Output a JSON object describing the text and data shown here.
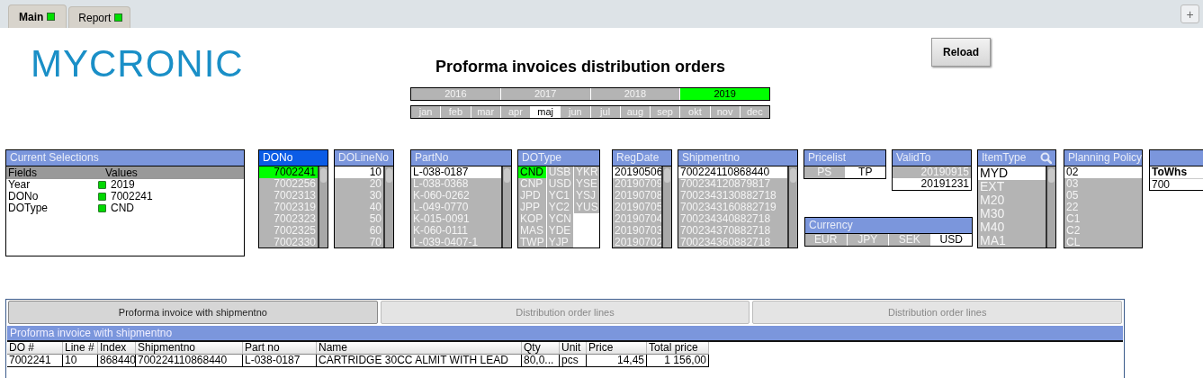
{
  "tabs": [
    {
      "label": "Main",
      "selected": true
    },
    {
      "label": "Report",
      "selected": false
    }
  ],
  "add_tab_button": "+",
  "logo": "MYCRONIC",
  "title": "Proforma invoices distribution orders",
  "reload_button": "Reload",
  "year_selector": [
    {
      "label": "2016",
      "selected": false,
      "excluded": true
    },
    {
      "label": "2017",
      "selected": false,
      "excluded": true
    },
    {
      "label": "2018",
      "selected": false,
      "excluded": true
    },
    {
      "label": "2019",
      "selected": true,
      "excluded": false
    }
  ],
  "month_selector": [
    {
      "label": "jan",
      "selected": false,
      "excluded": true
    },
    {
      "label": "feb",
      "selected": false,
      "excluded": true
    },
    {
      "label": "mar",
      "selected": false,
      "excluded": true
    },
    {
      "label": "apr",
      "selected": false,
      "excluded": true
    },
    {
      "label": "maj",
      "selected": false,
      "excluded": false
    },
    {
      "label": "jun",
      "selected": false,
      "excluded": true
    },
    {
      "label": "jul",
      "selected": false,
      "excluded": true
    },
    {
      "label": "aug",
      "selected": false,
      "excluded": true
    },
    {
      "label": "sep",
      "selected": false,
      "excluded": true
    },
    {
      "label": "okt",
      "selected": false,
      "excluded": true
    },
    {
      "label": "nov",
      "selected": false,
      "excluded": true
    },
    {
      "label": "dec",
      "selected": false,
      "excluded": true
    }
  ],
  "current_selections": {
    "title": "Current Selections",
    "columns": [
      "Fields",
      "Values"
    ],
    "rows": [
      {
        "field": "Year",
        "value": "2019"
      },
      {
        "field": "DONo",
        "value": "7002241"
      },
      {
        "field": "DOType",
        "value": "CND"
      }
    ]
  },
  "listboxes": [
    {
      "title": "DONo",
      "kind": "number",
      "active": true,
      "scrollbar": true,
      "items": [
        {
          "label": "7002241",
          "selected": true,
          "excluded": false
        },
        {
          "label": "7002256",
          "selected": false,
          "excluded": true
        },
        {
          "label": "7002313",
          "selected": false,
          "excluded": true
        },
        {
          "label": "7002319",
          "selected": false,
          "excluded": true
        },
        {
          "label": "7002323",
          "selected": false,
          "excluded": true
        },
        {
          "label": "7002325",
          "selected": false,
          "excluded": true
        },
        {
          "label": "7002330",
          "selected": false,
          "excluded": true
        }
      ]
    },
    {
      "title": "DOLineNo",
      "kind": "number",
      "active": false,
      "scrollbar": true,
      "items": [
        {
          "label": "10",
          "selected": false,
          "excluded": false
        },
        {
          "label": "20",
          "selected": false,
          "excluded": true
        },
        {
          "label": "30",
          "selected": false,
          "excluded": true
        },
        {
          "label": "40",
          "selected": false,
          "excluded": true
        },
        {
          "label": "50",
          "selected": false,
          "excluded": true
        },
        {
          "label": "60",
          "selected": false,
          "excluded": true
        },
        {
          "label": "70",
          "selected": false,
          "excluded": true
        }
      ]
    },
    {
      "title": "PartNo",
      "kind": "text",
      "active": false,
      "scrollbar": true,
      "items": [
        {
          "label": "L-038-0187",
          "selected": false,
          "excluded": false
        },
        {
          "label": "L-038-0368",
          "selected": false,
          "excluded": true
        },
        {
          "label": "K-060-0262",
          "selected": false,
          "excluded": true
        },
        {
          "label": "L-049-0770",
          "selected": false,
          "excluded": true
        },
        {
          "label": "K-015-0091",
          "selected": false,
          "excluded": true
        },
        {
          "label": "K-060-0111",
          "selected": false,
          "excluded": true
        },
        {
          "label": "L-039-0407-1",
          "selected": false,
          "excluded": true
        }
      ]
    },
    {
      "title": "DOType",
      "kind": "grid",
      "active": false,
      "scrollbar": false,
      "items": [
        {
          "label": "CND",
          "selected": true,
          "excluded": false
        },
        {
          "label": "CNP",
          "selected": false,
          "excluded": true
        },
        {
          "label": "JPD",
          "selected": false,
          "excluded": true
        },
        {
          "label": "JPP",
          "selected": false,
          "excluded": true
        },
        {
          "label": "KOP",
          "selected": false,
          "excluded": true
        },
        {
          "label": "MAS",
          "selected": false,
          "excluded": true
        },
        {
          "label": "TWP",
          "selected": false,
          "excluded": true
        },
        {
          "label": "USB",
          "selected": false,
          "excluded": true
        },
        {
          "label": "USD",
          "selected": false,
          "excluded": true
        },
        {
          "label": "YC1",
          "selected": false,
          "excluded": true
        },
        {
          "label": "YC2",
          "selected": false,
          "excluded": true
        },
        {
          "label": "YCN",
          "selected": false,
          "excluded": true
        },
        {
          "label": "YDE",
          "selected": false,
          "excluded": true
        },
        {
          "label": "YJP",
          "selected": false,
          "excluded": true
        },
        {
          "label": "YKR",
          "selected": false,
          "excluded": true
        },
        {
          "label": "YSE",
          "selected": false,
          "excluded": true
        },
        {
          "label": "YSJ",
          "selected": false,
          "excluded": true
        },
        {
          "label": "YUS",
          "selected": false,
          "excluded": true
        }
      ]
    },
    {
      "title": "RegDate",
      "kind": "number",
      "active": false,
      "scrollbar": true,
      "items": [
        {
          "label": "20190506",
          "selected": false,
          "excluded": false
        },
        {
          "label": "20190709",
          "selected": false,
          "excluded": true
        },
        {
          "label": "20190708",
          "selected": false,
          "excluded": true
        },
        {
          "label": "20190705",
          "selected": false,
          "excluded": true
        },
        {
          "label": "20190704",
          "selected": false,
          "excluded": true
        },
        {
          "label": "20190703",
          "selected": false,
          "excluded": true
        },
        {
          "label": "20190702",
          "selected": false,
          "excluded": true
        }
      ]
    },
    {
      "title": "Shipmentno",
      "kind": "text",
      "active": false,
      "scrollbar": true,
      "items": [
        {
          "label": "700224110868440",
          "selected": false,
          "excluded": false
        },
        {
          "label": "700234120879817",
          "selected": false,
          "excluded": true
        },
        {
          "label": "7002343130882718",
          "selected": false,
          "excluded": true
        },
        {
          "label": "7002343160882719",
          "selected": false,
          "excluded": true
        },
        {
          "label": "700234340882718",
          "selected": false,
          "excluded": true
        },
        {
          "label": "700234370882718",
          "selected": false,
          "excluded": true
        },
        {
          "label": "700234360882718",
          "selected": false,
          "excluded": true
        }
      ]
    },
    {
      "title": "Pricelist",
      "kind": "horizontal",
      "active": false,
      "scrollbar": false,
      "items": [
        {
          "label": "PS",
          "selected": false,
          "excluded": true
        },
        {
          "label": "TP",
          "selected": false,
          "excluded": false
        }
      ]
    },
    {
      "title": "ValidTo",
      "kind": "number",
      "active": false,
      "scrollbar": false,
      "items": [
        {
          "label": "20190915",
          "selected": false,
          "excluded": true
        },
        {
          "label": "20191231",
          "selected": false,
          "excluded": false
        }
      ]
    },
    {
      "title": "ItemType",
      "kind": "large",
      "active": false,
      "scrollbar": true,
      "search": true,
      "items": [
        {
          "label": "MYD",
          "selected": false,
          "excluded": false
        },
        {
          "label": "EXT",
          "selected": false,
          "excluded": true
        },
        {
          "label": "M20",
          "selected": false,
          "excluded": true
        },
        {
          "label": "M30",
          "selected": false,
          "excluded": true
        },
        {
          "label": "M40",
          "selected": false,
          "excluded": true
        },
        {
          "label": "MA1",
          "selected": false,
          "excluded": true
        }
      ]
    },
    {
      "title": "Planning Policy",
      "kind": "text",
      "active": false,
      "scrollbar": false,
      "items": [
        {
          "label": "02",
          "selected": false,
          "excluded": false
        },
        {
          "label": "03",
          "selected": false,
          "excluded": true
        },
        {
          "label": "05",
          "selected": false,
          "excluded": true
        },
        {
          "label": "22",
          "selected": false,
          "excluded": true
        },
        {
          "label": "C1",
          "selected": false,
          "excluded": true
        },
        {
          "label": "C2",
          "selected": false,
          "excluded": true
        },
        {
          "label": "CL",
          "selected": false,
          "excluded": true
        }
      ]
    }
  ],
  "currency_listbox": {
    "title": "Currency",
    "kind": "horizontal",
    "active": false,
    "scrollbar": false,
    "items": [
      {
        "label": "EUR",
        "selected": false,
        "excluded": true
      },
      {
        "label": "JPY",
        "selected": false,
        "excluded": true
      },
      {
        "label": "SEK",
        "selected": false,
        "excluded": true
      },
      {
        "label": "USD",
        "selected": false,
        "excluded": false
      }
    ]
  },
  "table_box": {
    "columns": [
      "ToWhs"
    ],
    "rows": [
      [
        "700"
      ]
    ]
  },
  "report_panel": {
    "buttons": [
      {
        "label": "Proforma invoice with shipmentno",
        "selected": true
      },
      {
        "label": "Distribution order lines",
        "selected": false
      },
      {
        "label": "Distribution order lines",
        "selected": false
      }
    ],
    "title": "Proforma invoice with shipmentno",
    "table": {
      "columns": [
        "DO #",
        "Line #",
        "Index",
        "Shipmentno",
        "Part no",
        "Name",
        "Qty",
        "Unit",
        "Price",
        "Total price"
      ],
      "rows": [
        [
          "7002241",
          "10",
          "868440",
          "700224110868440",
          "L-038-0187",
          "CARTRIDGE 30CC ALMIT WITH LEAD",
          "80,0...",
          "pcs",
          "14,45",
          "1 156,00"
        ]
      ]
    }
  }
}
